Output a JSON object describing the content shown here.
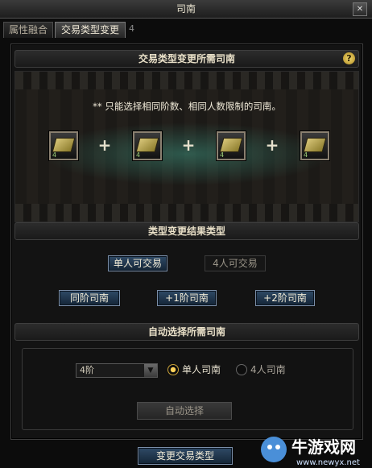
{
  "window": {
    "title": "司南",
    "close_glyph": "✕"
  },
  "tabs": [
    {
      "label": "属性融合",
      "active": false
    },
    {
      "label": "交易类型变更",
      "active": true
    }
  ],
  "tab_badge": "4",
  "section1": {
    "title": "交易类型变更所需司南",
    "help_glyph": "?",
    "note": "** 只能选择相同阶数、相同人数限制的司南。",
    "slot_count_label": "4",
    "plus_glyph": "+"
  },
  "section2": {
    "title": "类型变更结果类型",
    "type_buttons": [
      "单人可交易",
      "4人可交易"
    ],
    "grade_buttons": [
      "同阶司南",
      "+1阶司南",
      "+2阶司南"
    ]
  },
  "section3": {
    "title": "自动选择所需司南",
    "grade_select": "4阶",
    "radio_options": [
      {
        "label": "单人司南",
        "selected": true
      },
      {
        "label": "4人司南",
        "selected": false
      }
    ],
    "auto_button": "自动选择"
  },
  "footer": {
    "confirm_button": "变更交易类型"
  },
  "watermark": {
    "text": "牛游戏网",
    "url": "www.newyx.net"
  }
}
